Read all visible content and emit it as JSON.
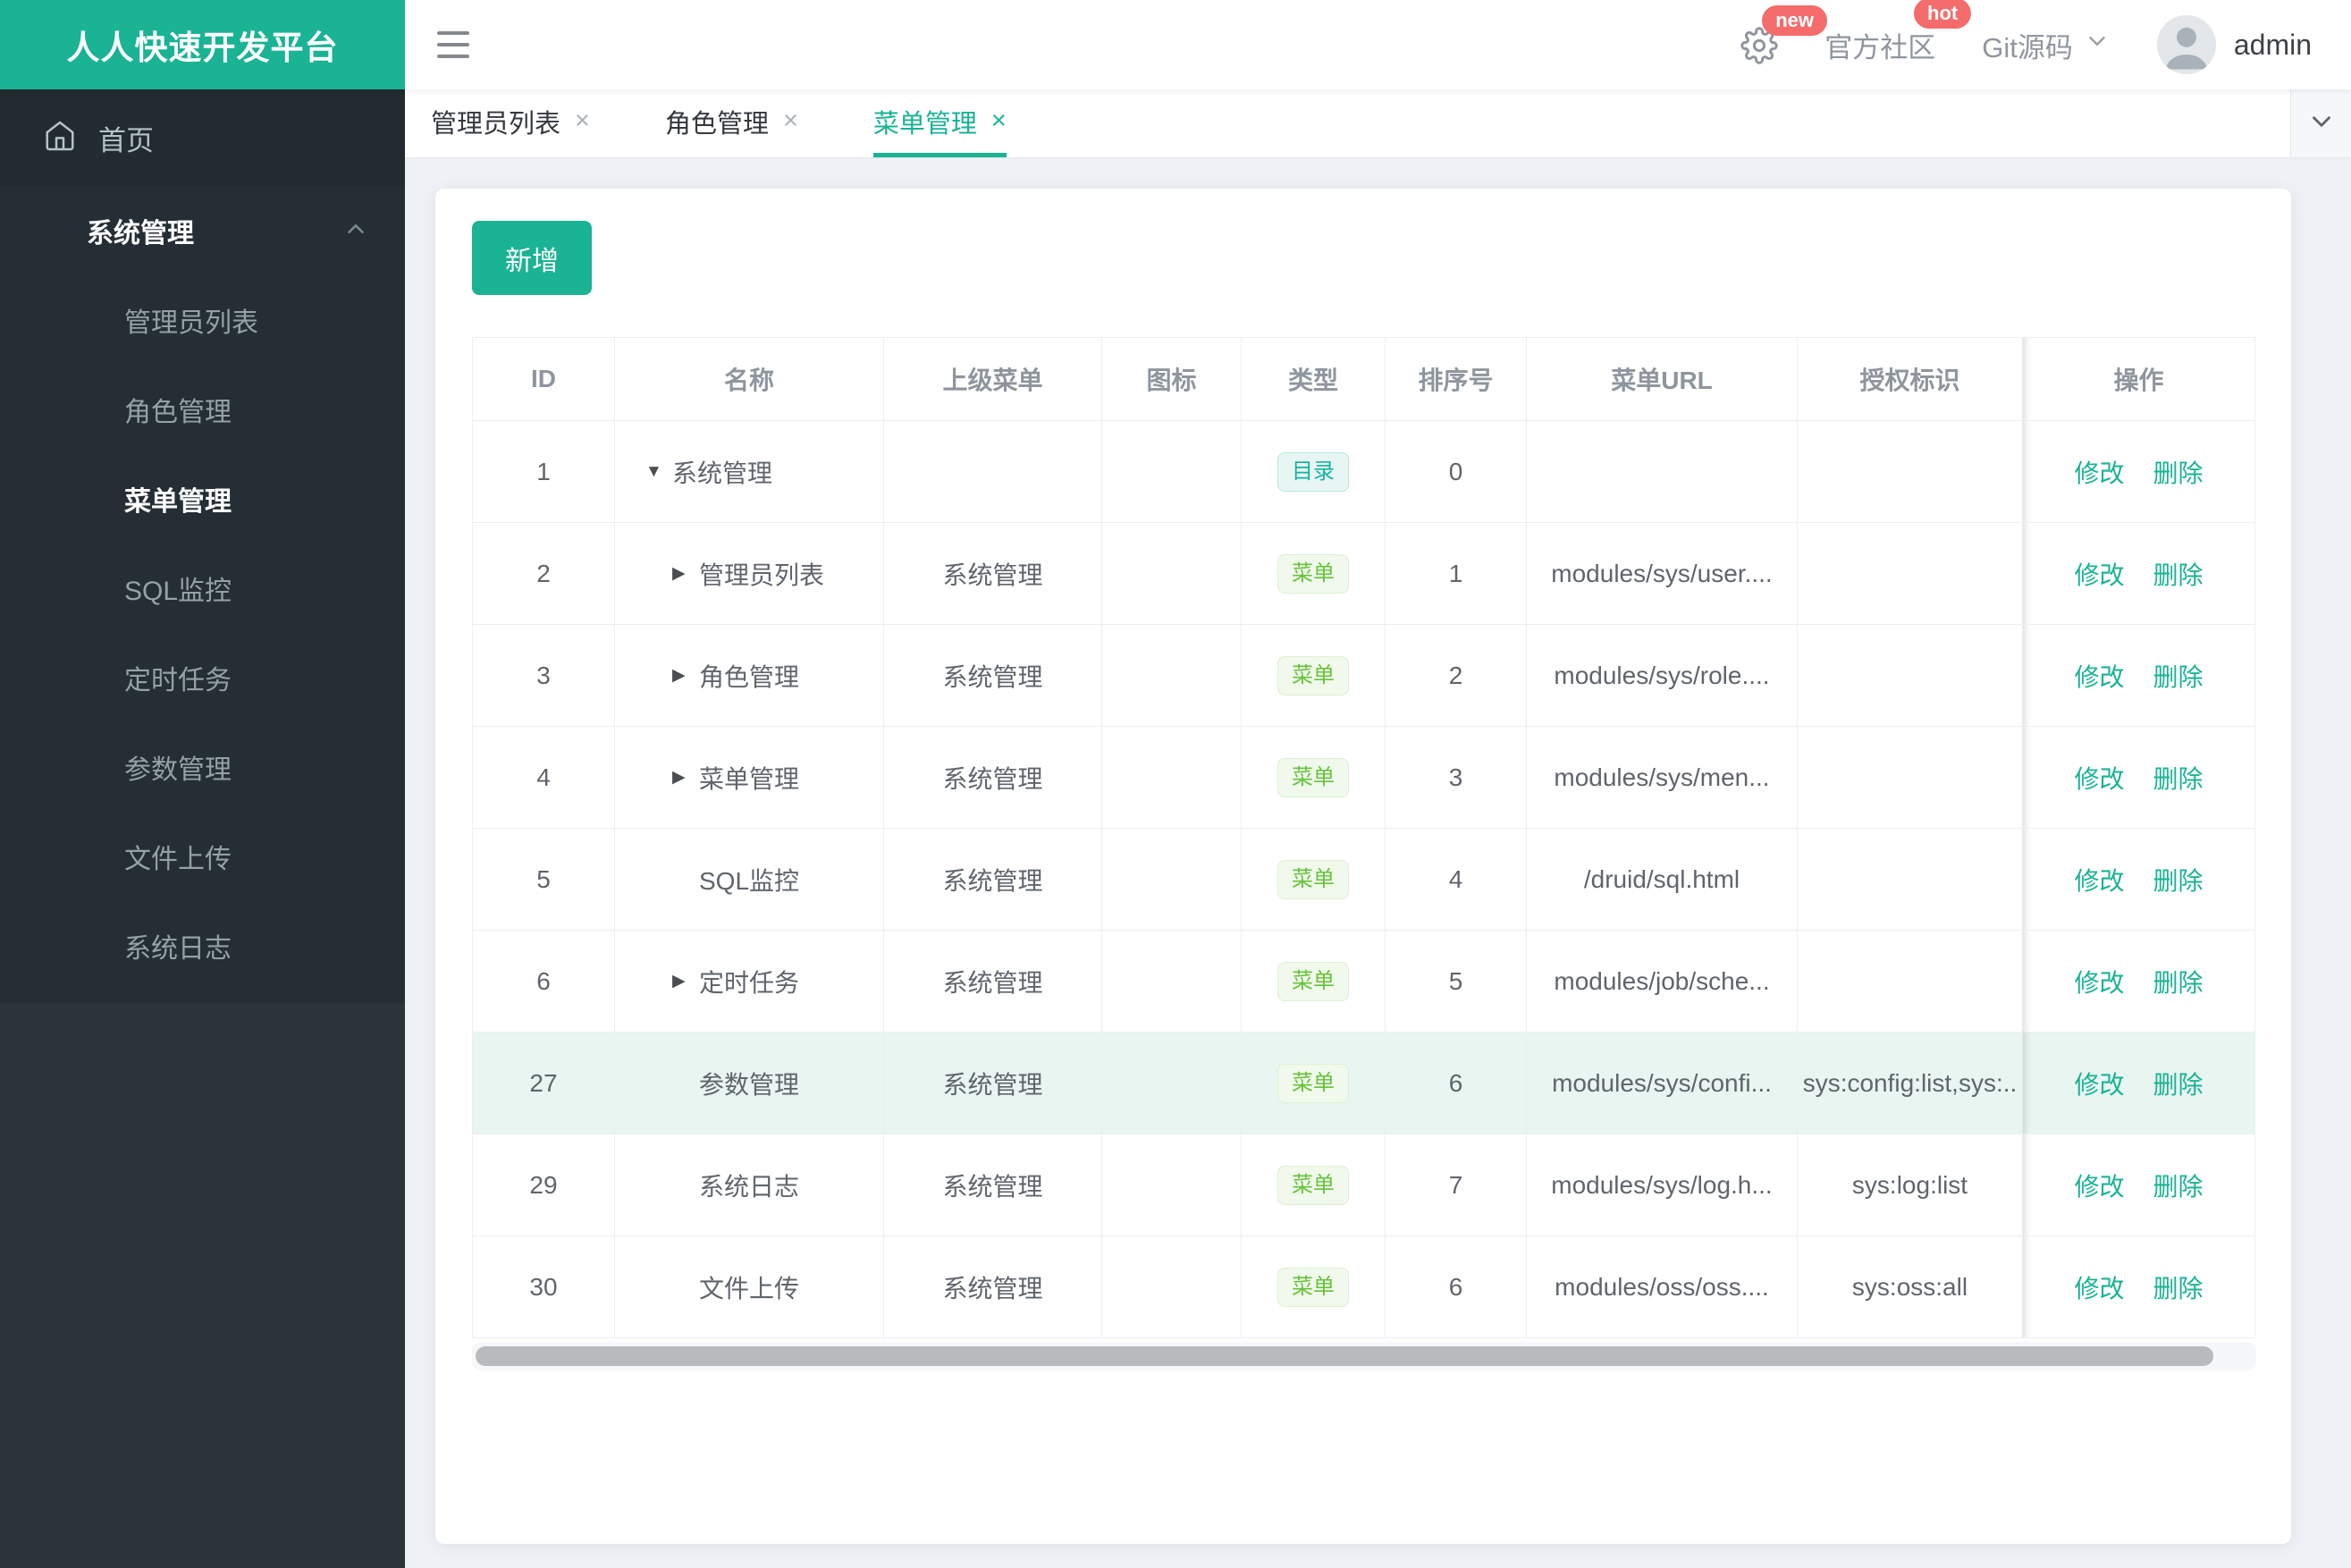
{
  "brand": {
    "title": "人人快速开发平台"
  },
  "header": {
    "settings_badge": "new",
    "community": {
      "label": "官方社区",
      "badge": "hot"
    },
    "git": {
      "label": "Git源码"
    },
    "user": {
      "name": "admin"
    }
  },
  "tabs": [
    {
      "label": "管理员列表",
      "active": false
    },
    {
      "label": "角色管理",
      "active": false
    },
    {
      "label": "菜单管理",
      "active": true
    }
  ],
  "sidebar": {
    "home_label": "首页",
    "group_label": "系统管理",
    "items": [
      {
        "label": "管理员列表",
        "active": false
      },
      {
        "label": "角色管理",
        "active": false
      },
      {
        "label": "菜单管理",
        "active": true
      },
      {
        "label": "SQL监控",
        "active": false
      },
      {
        "label": "定时任务",
        "active": false
      },
      {
        "label": "参数管理",
        "active": false
      },
      {
        "label": "文件上传",
        "active": false
      },
      {
        "label": "系统日志",
        "active": false
      }
    ]
  },
  "toolbar": {
    "add_label": "新增"
  },
  "table": {
    "headers": [
      "ID",
      "名称",
      "上级菜单",
      "图标",
      "类型",
      "排序号",
      "菜单URL",
      "授权标识",
      "操作"
    ],
    "action_labels": {
      "edit": "修改",
      "delete": "删除"
    },
    "rows": [
      {
        "id": "1",
        "arrow": "down",
        "name": "系统管理",
        "parent": "",
        "icon": "",
        "type": "目录",
        "type_kind": "dir",
        "order": "0",
        "url": "",
        "perm": "",
        "highlight": false
      },
      {
        "id": "2",
        "arrow": "right",
        "name": "管理员列表",
        "parent": "系统管理",
        "icon": "",
        "type": "菜单",
        "type_kind": "menu",
        "order": "1",
        "url": "modules/sys/user....",
        "perm": "",
        "highlight": false
      },
      {
        "id": "3",
        "arrow": "right",
        "name": "角色管理",
        "parent": "系统管理",
        "icon": "",
        "type": "菜单",
        "type_kind": "menu",
        "order": "2",
        "url": "modules/sys/role....",
        "perm": "",
        "highlight": false
      },
      {
        "id": "4",
        "arrow": "right",
        "name": "菜单管理",
        "parent": "系统管理",
        "icon": "",
        "type": "菜单",
        "type_kind": "menu",
        "order": "3",
        "url": "modules/sys/men...",
        "perm": "",
        "highlight": false
      },
      {
        "id": "5",
        "arrow": "none",
        "name": "SQL监控",
        "parent": "系统管理",
        "icon": "",
        "type": "菜单",
        "type_kind": "menu",
        "order": "4",
        "url": "/druid/sql.html",
        "perm": "",
        "highlight": false
      },
      {
        "id": "6",
        "arrow": "right",
        "name": "定时任务",
        "parent": "系统管理",
        "icon": "",
        "type": "菜单",
        "type_kind": "menu",
        "order": "5",
        "url": "modules/job/sche...",
        "perm": "",
        "highlight": false
      },
      {
        "id": "27",
        "arrow": "none",
        "name": "参数管理",
        "parent": "系统管理",
        "icon": "",
        "type": "菜单",
        "type_kind": "menu",
        "order": "6",
        "url": "modules/sys/confi...",
        "perm": "sys:config:list,sys:..",
        "highlight": true
      },
      {
        "id": "29",
        "arrow": "none",
        "name": "系统日志",
        "parent": "系统管理",
        "icon": "",
        "type": "菜单",
        "type_kind": "menu",
        "order": "7",
        "url": "modules/sys/log.h...",
        "perm": "sys:log:list",
        "highlight": false
      },
      {
        "id": "30",
        "arrow": "none",
        "name": "文件上传",
        "parent": "系统管理",
        "icon": "",
        "type": "菜单",
        "type_kind": "menu",
        "order": "6",
        "url": "modules/oss/oss....",
        "perm": "sys:oss:all",
        "highlight": false
      }
    ]
  },
  "colors": {
    "accent": "#1ab394",
    "danger_badge": "#f56c6c",
    "tag_dir_text": "#18b3a3",
    "tag_menu_text": "#67c23a",
    "row_highlight": "#e9f5f1",
    "sidebar_bg": "#2a343a",
    "sidebar_panel_bg": "#242e34",
    "table_border": "#ebeef5"
  }
}
